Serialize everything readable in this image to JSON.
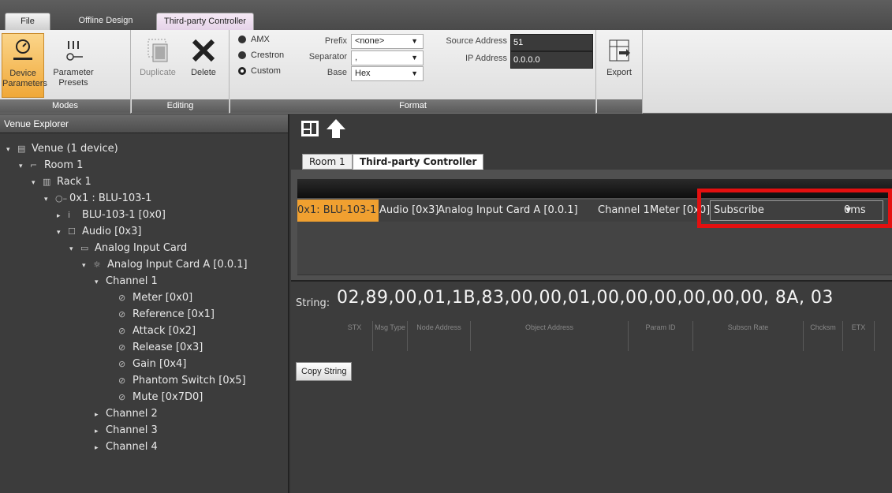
{
  "tabs": {
    "file": "File",
    "offline": "Offline Design",
    "tpc": "Third-party Controller"
  },
  "modes": {
    "device_params": "Device Parameters",
    "param_presets": "Parameter Presets",
    "group": "Modes"
  },
  "editing": {
    "duplicate": "Duplicate",
    "delete": "Delete",
    "group": "Editing"
  },
  "format": {
    "group": "Format",
    "radios": [
      "AMX",
      "Crestron",
      "Custom"
    ],
    "prefix_label": "Prefix",
    "prefix_value": "<none>",
    "separator_label": "Separator",
    "separator_value": ",",
    "base_label": "Base",
    "base_value": "Hex",
    "source_label": "Source Address",
    "source_value": "51",
    "ip_label": "IP Address",
    "ip_value": "0.0.0.0"
  },
  "export": {
    "label": "Export"
  },
  "explorer": {
    "title": "Venue Explorer",
    "nodes": [
      {
        "text": "Venue (1 device)",
        "twisty": "▾",
        "icon": "▤",
        "indent": 0
      },
      {
        "text": "Room 1",
        "twisty": "▾",
        "icon": "⌐",
        "indent": 1
      },
      {
        "text": "Rack 1",
        "twisty": "▾",
        "icon": "▥",
        "indent": 2
      },
      {
        "text": "0x1 : BLU-103-1",
        "twisty": "▾",
        "icon": "○–",
        "indent": 3
      },
      {
        "text": "BLU-103-1 [0x0]",
        "twisty": "▸",
        "icon": "i",
        "indent": 4
      },
      {
        "text": "Audio [0x3]",
        "twisty": "▾",
        "icon": "☐",
        "indent": 4
      },
      {
        "text": "Analog Input Card",
        "twisty": "▾",
        "icon": "▭",
        "indent": 5
      },
      {
        "text": "Analog Input Card A [0.0.1]",
        "twisty": "▾",
        "icon": "☼",
        "indent": 6
      },
      {
        "text": "Channel 1",
        "twisty": "▾",
        "icon": "",
        "indent": 7
      },
      {
        "text": "Meter [0x0]",
        "twisty": "",
        "icon": "⊘",
        "indent": 8
      },
      {
        "text": "Reference [0x1]",
        "twisty": "",
        "icon": "⊘",
        "indent": 8
      },
      {
        "text": "Attack [0x2]",
        "twisty": "",
        "icon": "⊘",
        "indent": 8
      },
      {
        "text": "Release [0x3]",
        "twisty": "",
        "icon": "⊘",
        "indent": 8
      },
      {
        "text": "Gain [0x4]",
        "twisty": "",
        "icon": "⊘",
        "indent": 8
      },
      {
        "text": "Phantom Switch [0x5]",
        "twisty": "",
        "icon": "⊘",
        "indent": 8
      },
      {
        "text": "Mute [0x7D0]",
        "twisty": "",
        "icon": "⊘",
        "indent": 8
      },
      {
        "text": "Channel 2",
        "twisty": "▸",
        "icon": "",
        "indent": 7
      },
      {
        "text": "Channel 3",
        "twisty": "▸",
        "icon": "",
        "indent": 7
      },
      {
        "text": "Channel 4",
        "twisty": "▸",
        "icon": "",
        "indent": 7
      }
    ]
  },
  "doc_tabs": {
    "room": "Room 1",
    "tpc": "Third-party Controller"
  },
  "grid": {
    "device": "0x1: BLU-103-1",
    "object": "Audio [0x3]",
    "card": "Analog Input Card A [0.0.1]",
    "channel": "Channel 1",
    "param": "Meter [0x0]",
    "action": "Subscribe",
    "rate": "0ms"
  },
  "string": {
    "label": "String:",
    "value": "02,89,00,01,1B,83,00,00,01,00,00,00,00,00,00, 8A, 03",
    "fields": [
      "STX",
      "Msg Type",
      "Node Address",
      "Object Address",
      "Param ID",
      "Subscn Rate",
      "Chcksm",
      "ETX"
    ],
    "copy": "Copy String"
  }
}
